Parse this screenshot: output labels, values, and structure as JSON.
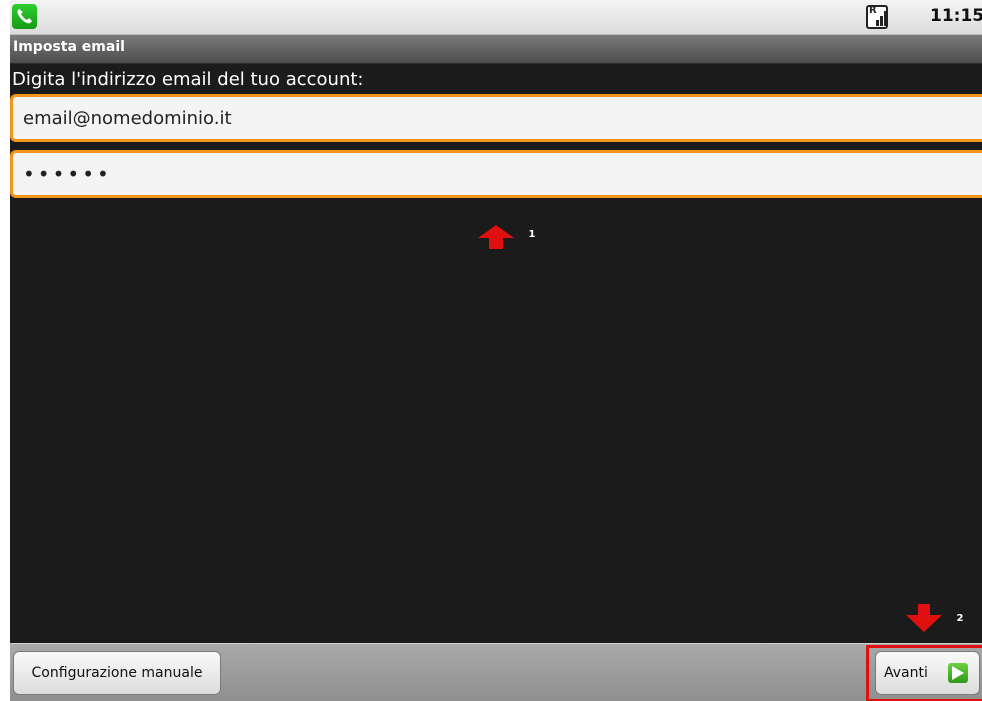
{
  "status_bar": {
    "time": "11:15",
    "left_icon": "phone-icon",
    "signal_icon": "signal-icon"
  },
  "title_bar": {
    "title": "Imposta email"
  },
  "form": {
    "prompt": "Digita l'indirizzo email del tuo account:",
    "email_value": "email@nomedominio.it",
    "password_value": "••••••"
  },
  "annotations": {
    "step1": "1",
    "step2": "2",
    "color": "#e01010"
  },
  "buttons": {
    "manual_label": "Configurazione manuale",
    "next_label": "Avanti"
  },
  "colors": {
    "focus_border": "#f3941c",
    "background": "#1b1b1b"
  }
}
